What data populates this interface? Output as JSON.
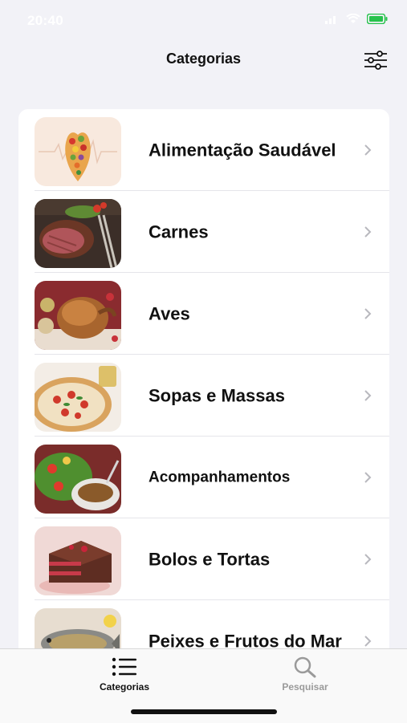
{
  "status_bar": {
    "time": "20:40"
  },
  "nav": {
    "title": "Categorias"
  },
  "categories": [
    {
      "label": "Alimentação Saudável"
    },
    {
      "label": "Carnes"
    },
    {
      "label": "Aves"
    },
    {
      "label": "Sopas e Massas"
    },
    {
      "label": "Acompanhamentos"
    },
    {
      "label": "Bolos e Tortas"
    },
    {
      "label": "Peixes e Frutos do Mar"
    }
  ],
  "tabs": [
    {
      "label": "Categorias",
      "active": true
    },
    {
      "label": "Pesquisar",
      "active": false
    }
  ],
  "colors": {
    "background": "#f2f2f7",
    "card": "#ffffff",
    "inactive_tab": "#9a9a9a"
  }
}
